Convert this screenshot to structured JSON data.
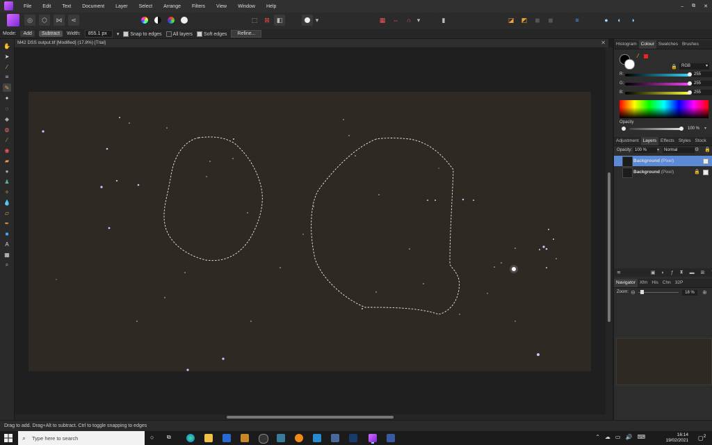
{
  "menu": [
    "File",
    "Edit",
    "Text",
    "Document",
    "Layer",
    "Select",
    "Arrange",
    "Filters",
    "View",
    "Window",
    "Help"
  ],
  "window_controls": [
    "–",
    "⧉",
    "✕"
  ],
  "context": {
    "mode_label": "Mode:",
    "mode_add": "Add",
    "mode_subtract": "Subtract",
    "width_label": "Width:",
    "width_value": "855.1 px",
    "snap_label": "Snap to edges",
    "all_layers_label": "All layers",
    "soft_edges_label": "Soft edges",
    "refine_label": "Refine..."
  },
  "document_title": "M42 DSS output.tif [Modified] (17.8%) [Trial]",
  "color_panel": {
    "tabs": [
      "Histogram",
      "Colour",
      "Swatches",
      "Brushes"
    ],
    "active_tab": "Colour",
    "model": "RGB",
    "channels": [
      {
        "label": "R:",
        "value": "255",
        "color": "#3ad6ff"
      },
      {
        "label": "G:",
        "value": "255",
        "color": "#ff40ff"
      },
      {
        "label": "B:",
        "value": "255",
        "color": "#ffff40"
      }
    ],
    "opacity_label": "Opacity",
    "opacity_value": "100 %"
  },
  "layers_panel": {
    "tabs": [
      "Adjustment",
      "Layers",
      "Effects",
      "Styles",
      "Stock"
    ],
    "active_tab": "Layers",
    "opacity_label": "Opacity:",
    "opacity_value": "100 %",
    "blend_mode": "Normal",
    "layers": [
      {
        "name": "Background",
        "type": "(Pixel)",
        "selected": true
      },
      {
        "name": "Background",
        "type": "(Pixel)",
        "selected": false
      }
    ]
  },
  "navigator_panel": {
    "tabs": [
      "Navigator",
      "Xfm",
      "His",
      "Chn",
      "32P"
    ],
    "active_tab": "Navigator",
    "zoom_label": "Zoom:",
    "zoom_value": "18 %"
  },
  "status_text": "Drag to add. Drag+Alt to subtract. Ctrl to toggle snapping to edges",
  "taskbar": {
    "search_placeholder": "Type here to search",
    "time": "16:14",
    "date": "19/02/2021",
    "notification_count": "2"
  },
  "colors": {
    "accent": "#5b8ad6",
    "app_logo": "#b44cff",
    "image_background": "#2e2a23",
    "star": "#c8c8ff"
  }
}
